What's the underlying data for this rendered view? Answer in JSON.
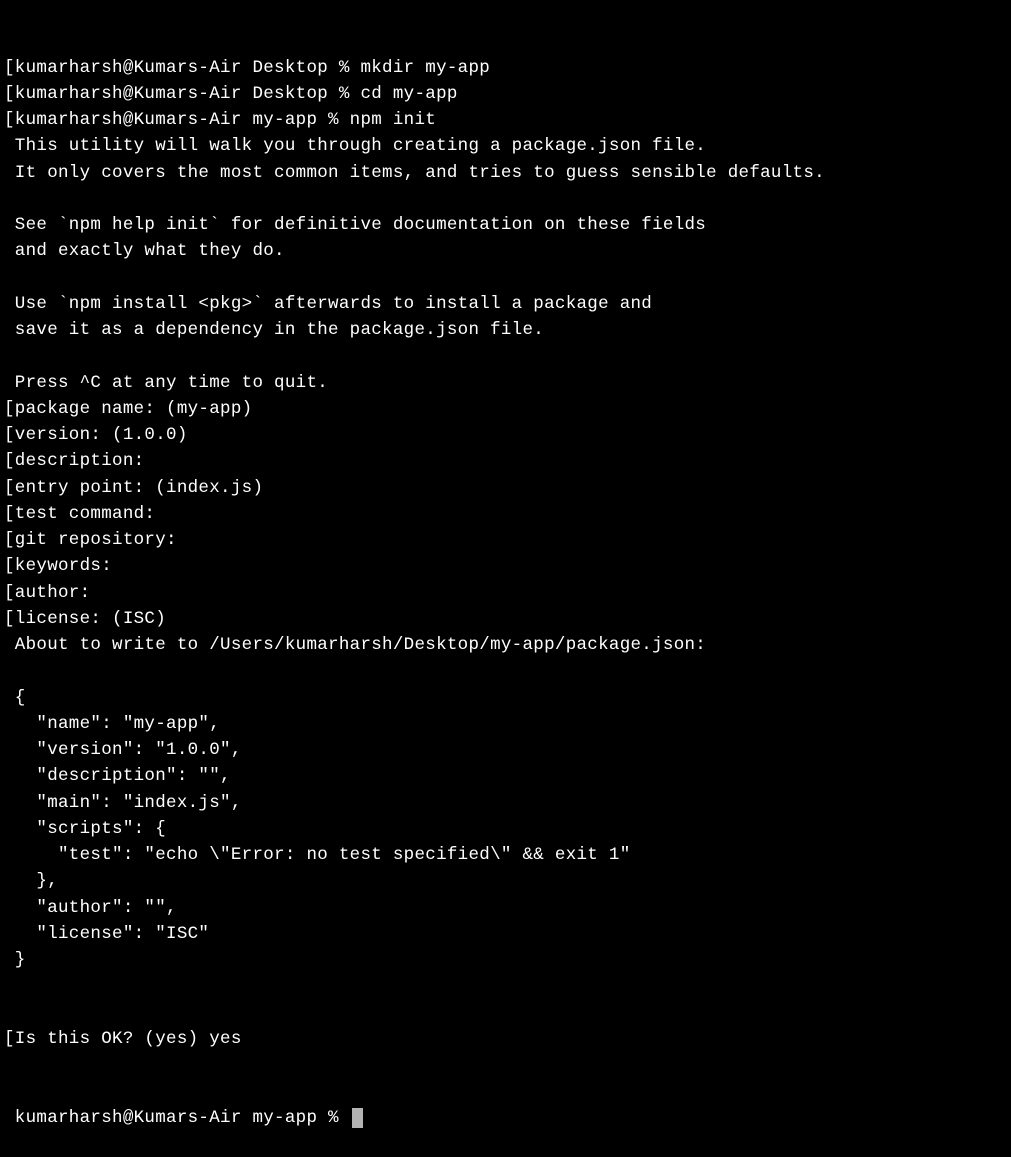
{
  "lines": [
    "[kumarharsh@Kumars-Air Desktop % mkdir my-app",
    "[kumarharsh@Kumars-Air Desktop % cd my-app",
    "[kumarharsh@Kumars-Air my-app % npm init",
    " This utility will walk you through creating a package.json file.",
    " It only covers the most common items, and tries to guess sensible defaults.",
    "",
    " See `npm help init` for definitive documentation on these fields",
    " and exactly what they do.",
    "",
    " Use `npm install <pkg>` afterwards to install a package and",
    " save it as a dependency in the package.json file.",
    "",
    " Press ^C at any time to quit.",
    "[package name: (my-app)",
    "[version: (1.0.0)",
    "[description:",
    "[entry point: (index.js)",
    "[test command:",
    "[git repository:",
    "[keywords:",
    "[author:",
    "[license: (ISC)",
    " About to write to /Users/kumarharsh/Desktop/my-app/package.json:",
    "",
    " {",
    "   \"name\": \"my-app\",",
    "   \"version\": \"1.0.0\",",
    "   \"description\": \"\",",
    "   \"main\": \"index.js\",",
    "   \"scripts\": {",
    "     \"test\": \"echo \\\"Error: no test specified\\\" && exit 1\"",
    "   },",
    "   \"author\": \"\",",
    "   \"license\": \"ISC\"",
    " }",
    "",
    "",
    "[Is this OK? (yes) yes"
  ],
  "final_prompt": " kumarharsh@Kumars-Air my-app % "
}
